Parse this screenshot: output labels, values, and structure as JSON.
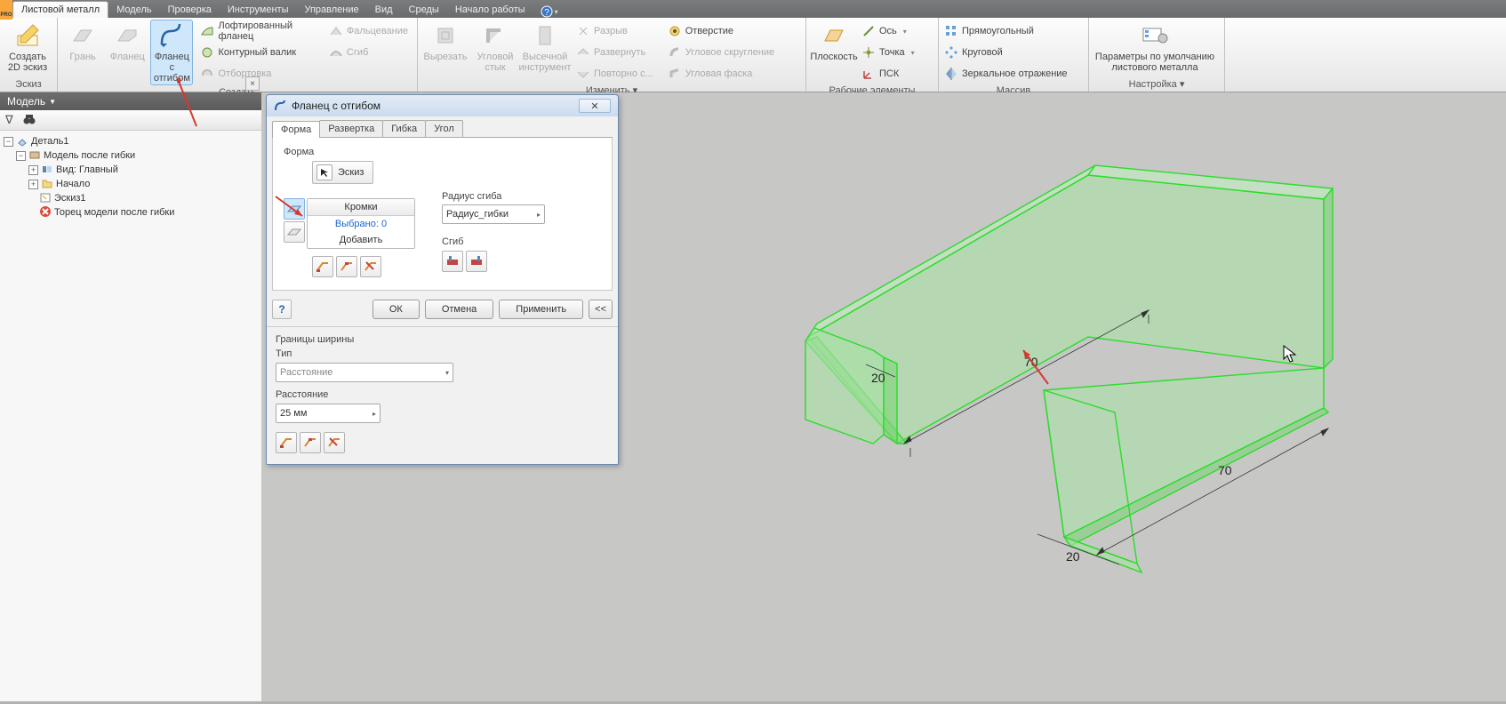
{
  "tabs": {
    "pro": "PRO",
    "items": [
      "Листовой металл",
      "Модель",
      "Проверка",
      "Инструменты",
      "Управление",
      "Вид",
      "Среды",
      "Начало работы"
    ],
    "active": 0
  },
  "ribbon": {
    "groups": {
      "sketch": {
        "title": "Эскиз",
        "btn": "Создать\n2D эскиз"
      },
      "create": {
        "title": "Создать",
        "big": [
          {
            "label": "Грань"
          },
          {
            "label": "Фланец"
          },
          {
            "label": "Фланец с\nотгибом"
          }
        ],
        "small": [
          "Лофтированный фланец",
          "Контурный валик",
          "Отбортовка",
          "Фальцевание",
          "Сгиб"
        ]
      },
      "modify": {
        "title": "Изменить ▾",
        "big": [
          {
            "label": "Вырезать"
          },
          {
            "label": "Угловой\nстык"
          },
          {
            "label": "Высечной\nинструмент"
          }
        ],
        "small": [
          "Разрыв",
          "Развернуть",
          "Повторно с...",
          "Отверстие",
          "Угловое скругление",
          "Угловая фаска"
        ]
      },
      "work": {
        "title": "Рабочие элементы",
        "big": "Плоскость",
        "small": [
          "Ось",
          "Точка",
          "ПСК"
        ]
      },
      "array": {
        "title": "Массив",
        "small": [
          "Прямоугольный",
          "Круговой",
          "Зеркальное отражение"
        ]
      },
      "setup": {
        "title": "Настройка ▾",
        "big": "Параметры по умолчанию\nлистового металла"
      }
    }
  },
  "panel": {
    "title": "Модель",
    "filter_icon": "∇",
    "part": "Деталь1",
    "tree": [
      {
        "label": "Модель после гибки",
        "icon": "model"
      },
      {
        "label": "Вид: Главный",
        "icon": "view",
        "indent": 1
      },
      {
        "label": "Начало",
        "icon": "folder",
        "indent": 1
      },
      {
        "label": "Эскиз1",
        "icon": "sketch",
        "indent": 1
      },
      {
        "label": "Торец модели после гибки",
        "icon": "error",
        "indent": 1
      }
    ]
  },
  "dialog": {
    "title": "Фланец с отгибом",
    "tabs": [
      "Форма",
      "Развертка",
      "Гибка",
      "Угол"
    ],
    "active_tab": 0,
    "group1_label": "Форма",
    "sketch_btn": "Эскиз",
    "edges_header": "Кромки",
    "edges_selected": "Выбрано: 0",
    "edges_add": "Добавить",
    "radius_label": "Радиус сгиба",
    "radius_value": "Радиус_гибки",
    "bend_label": "Сгиб",
    "ok": "ОК",
    "cancel": "Отмена",
    "apply": "Применить",
    "expand": "<<",
    "width_bounds": "Границы ширины",
    "type_label": "Тип",
    "type_value": "Расстояние",
    "distance_label": "Расстояние",
    "distance_value": "25 мм"
  },
  "dims": {
    "d1": "70",
    "d2": "20",
    "d3": "70",
    "d4": "20"
  }
}
